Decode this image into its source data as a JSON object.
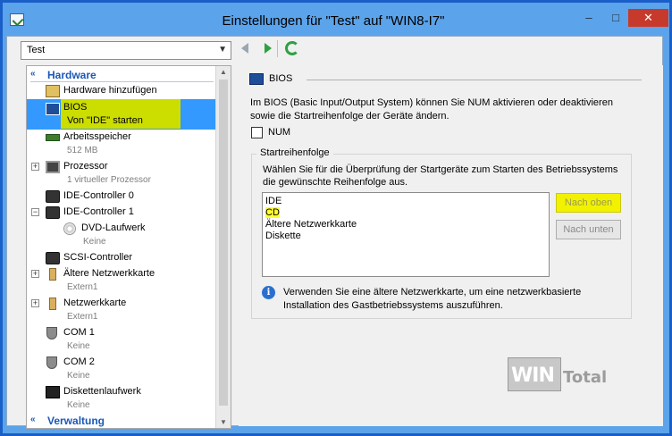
{
  "window": {
    "title": "Einstellungen für \"Test\" auf \"WIN8-I7\"",
    "minimize": "–",
    "maximize": "□",
    "close": "✕"
  },
  "vm_selector": {
    "selected": "Test"
  },
  "tree": {
    "hardware_section": "Hardware",
    "management_section": "Verwaltung",
    "items": [
      {
        "label": "Hardware hinzufügen",
        "sub": "",
        "icon": "add-hardware-icon"
      },
      {
        "label": "BIOS",
        "sub": "Von \"IDE\" starten",
        "icon": "bios-icon",
        "selected": true
      },
      {
        "label": "Arbeitsspeicher",
        "sub": "512 MB",
        "icon": "memory-icon"
      },
      {
        "label": "Prozessor",
        "sub": "1 virtueller Prozessor",
        "icon": "processor-icon"
      },
      {
        "label": "IDE-Controller 0",
        "sub": "",
        "icon": "disk-controller-icon"
      },
      {
        "label": "IDE-Controller 1",
        "sub": "",
        "icon": "disk-controller-icon"
      },
      {
        "label": "DVD-Laufwerk",
        "sub": "Keine",
        "icon": "dvd-icon"
      },
      {
        "label": "SCSI-Controller",
        "sub": "",
        "icon": "disk-controller-icon"
      },
      {
        "label": "Ältere Netzwerkkarte",
        "sub": "Extern1",
        "icon": "network-adapter-icon"
      },
      {
        "label": "Netzwerkkarte",
        "sub": "Extern1",
        "icon": "network-adapter-icon"
      },
      {
        "label": "COM 1",
        "sub": "Keine",
        "icon": "com-port-icon"
      },
      {
        "label": "COM 2",
        "sub": "Keine",
        "icon": "com-port-icon"
      },
      {
        "label": "Diskettenlaufwerk",
        "sub": "Keine",
        "icon": "floppy-icon"
      }
    ],
    "expand_plus": "+",
    "expand_minus": "−"
  },
  "bios": {
    "header": "BIOS",
    "description_line1": "Im BIOS (Basic Input/Output System) können Sie NUM aktivieren oder deaktivieren",
    "description_line2": "sowie die Startreihenfolge der Geräte ändern.",
    "numlock_label": "NUM",
    "numlock_checked": false,
    "startup_group_title": "Startreihenfolge",
    "startup_desc_line1": "Wählen Sie für die Überprüfung der Startgeräte zum Starten des Betriebssystems",
    "startup_desc_line2": "die gewünschte Reihenfolge aus.",
    "boot_order": [
      "IDE",
      "CD",
      "Ältere Netzwerkkarte",
      "Diskette"
    ],
    "boot_selected": "CD",
    "move_up": "Nach oben",
    "move_down": "Nach unten",
    "info_line1": "Verwenden Sie eine ältere Netzwerkkarte, um eine netzwerkbasierte",
    "info_line2": "Installation des Gastbetriebssystems auszuführen."
  },
  "watermark": {
    "part1": "WIN",
    "part2": "Total"
  },
  "colors": {
    "title_bar": "#5ba3ea",
    "selection": "#3399ff",
    "highlight_yellow": "#ccdd00",
    "section_blue": "#1b58b8",
    "close_red": "#c7392b"
  }
}
